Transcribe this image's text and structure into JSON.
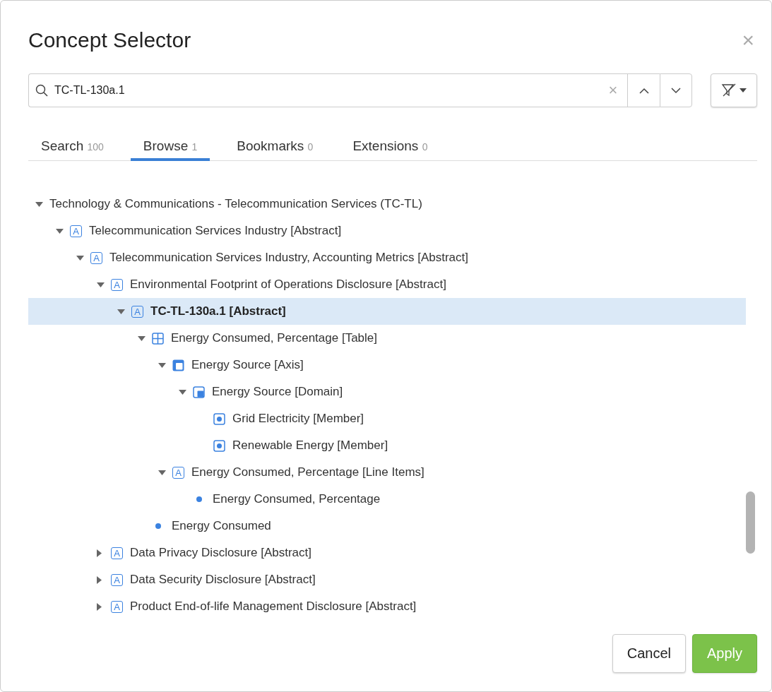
{
  "dialog": {
    "title": "Concept Selector",
    "close": "×"
  },
  "search": {
    "value": "TC-TL-130a.1",
    "clear": "×"
  },
  "tabs": [
    {
      "label": "Search",
      "count": "100",
      "selected": false
    },
    {
      "label": "Browse",
      "count": "1",
      "selected": true
    },
    {
      "label": "Bookmarks",
      "count": "0",
      "selected": false
    },
    {
      "label": "Extensions",
      "count": "0",
      "selected": false
    }
  ],
  "tree": [
    {
      "label": "Technology & Communications - Telecommunication Services (TC-TL)",
      "expanded": true,
      "selected": false,
      "children": [
        {
          "kind": "abstract",
          "icon": "A",
          "label": "Telecommunication Services Industry [Abstract]",
          "expanded": true,
          "selected": false,
          "children": [
            {
              "kind": "abstract",
              "icon": "A",
              "label": "Telecommunication Services Industry, Accounting Metrics [Abstract]",
              "expanded": true,
              "selected": false,
              "children": [
                {
                  "kind": "abstract",
                  "icon": "A",
                  "label": "Environmental Footprint of Operations Disclosure [Abstract]",
                  "expanded": true,
                  "selected": false,
                  "children": [
                    {
                      "kind": "abstract",
                      "icon": "A",
                      "label": "TC-TL-130a.1 [Abstract]",
                      "expanded": true,
                      "selected": true,
                      "children": [
                        {
                          "kind": "table",
                          "label": "Energy Consumed, Percentage [Table]",
                          "expanded": true,
                          "selected": false,
                          "children": [
                            {
                              "kind": "axis",
                              "label": "Energy Source [Axis]",
                              "expanded": true,
                              "selected": false,
                              "children": [
                                {
                                  "kind": "domain",
                                  "label": "Energy Source [Domain]",
                                  "expanded": true,
                                  "selected": false,
                                  "children": [
                                    {
                                      "kind": "member",
                                      "label": "Grid Electricity [Member]",
                                      "selected": false
                                    },
                                    {
                                      "kind": "member",
                                      "label": "Renewable Energy [Member]",
                                      "selected": false
                                    }
                                  ]
                                }
                              ]
                            },
                            {
                              "kind": "abstract",
                              "icon": "A",
                              "label": "Energy Consumed, Percentage [Line Items]",
                              "expanded": true,
                              "selected": false,
                              "children": [
                                {
                                  "kind": "item",
                                  "label": "Energy Consumed, Percentage",
                                  "selected": false
                                }
                              ]
                            }
                          ]
                        },
                        {
                          "kind": "item",
                          "label": "Energy Consumed",
                          "selected": false
                        }
                      ]
                    }
                  ]
                },
                {
                  "kind": "abstract",
                  "icon": "A",
                  "label": "Data Privacy Disclosure [Abstract]",
                  "expanded": false,
                  "selected": false
                },
                {
                  "kind": "abstract",
                  "icon": "A",
                  "label": "Data Security Disclosure [Abstract]",
                  "expanded": false,
                  "selected": false
                },
                {
                  "kind": "abstract",
                  "icon": "A",
                  "label": "Product End-of-life Management Disclosure [Abstract]",
                  "expanded": false,
                  "selected": false
                }
              ]
            }
          ]
        }
      ]
    }
  ],
  "buttons": [
    {
      "kind": "secondary",
      "label": "Cancel"
    },
    {
      "kind": "primary",
      "label": "Apply"
    }
  ]
}
